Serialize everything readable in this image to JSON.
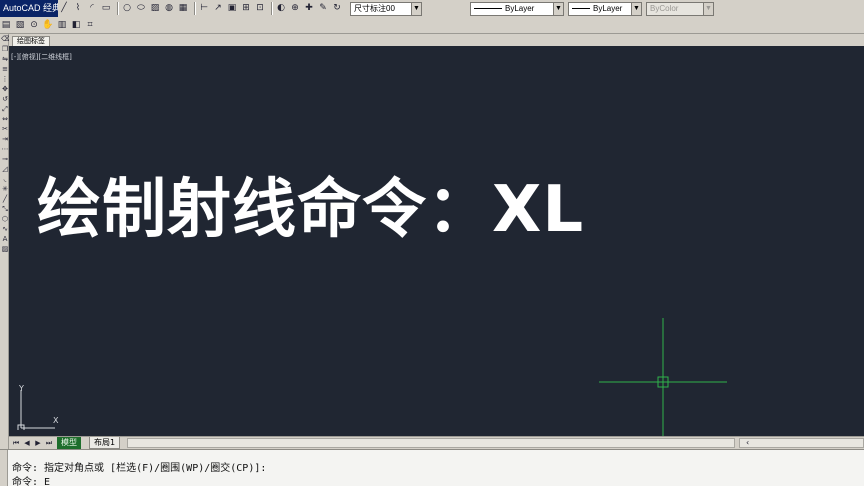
{
  "app": {
    "title": "AutoCAD 经典"
  },
  "toolbar": {
    "row1_icons": [
      "line-icon",
      "polyline-icon",
      "arc-icon",
      "rectangle-icon",
      "circle-icon",
      "ellipse-icon",
      "hatch-icon",
      "region-icon",
      "table-icon",
      "text-icon",
      "dimension-icon",
      "leader-icon",
      "block-icon",
      "insert-icon",
      "point-icon",
      "gradient-icon",
      "tolerance-icon",
      "center-mark-icon",
      "edit-icon",
      "update-icon"
    ],
    "row2_icons": [
      "save-icon",
      "open-icon",
      "zoom-icon",
      "pan-icon",
      "properties-icon",
      "layer-icon",
      "match-icon"
    ],
    "dim_style": "尺寸标注00",
    "linetype": "ByLayer",
    "lineweight": "ByLayer",
    "plot_style": "ByColor"
  },
  "drawing_tab": {
    "label": "绘图标签"
  },
  "canvas": {
    "viewport_label": "[-][俯视][二维线框]",
    "overlay_title": "绘制射线命令：XL",
    "ucs_x": "X",
    "ucs_y": "Y",
    "background_color": "#202632",
    "crosshair_color": "#2fb34a"
  },
  "layout_tabs": {
    "model": "模型",
    "layout1": "布局1"
  },
  "command": {
    "line1": "命令: 指定对角点或 [栏选(F)/圈围(WP)/圈交(CP)]:",
    "line2": "命令: E"
  }
}
